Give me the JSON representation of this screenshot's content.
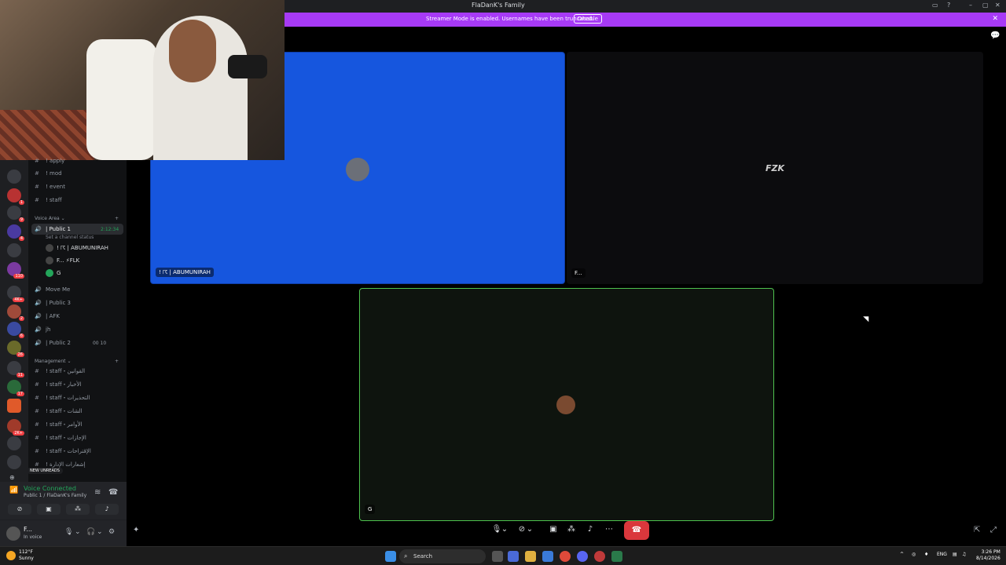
{
  "window": {
    "title": "FlaDanK's Family"
  },
  "banner": {
    "message": "Streamer Mode is enabled. Usernames have been truncated.",
    "disable_label": "Disable"
  },
  "channels": {
    "text": [
      {
        "name": "! apply"
      },
      {
        "name": "! mod"
      },
      {
        "name": "! event"
      },
      {
        "name": "! staff"
      }
    ],
    "voice_area": {
      "category": "Voice Area",
      "active_channel": {
        "name": "| Public 1",
        "timer": "2:12:34",
        "status": "Set a channel status"
      },
      "members": [
        "! ☈ | ABUMUNIRAH",
        "F... ⚡FLK",
        "G"
      ],
      "others": [
        {
          "name": "Move Me"
        },
        {
          "name": "| Public 3"
        },
        {
          "name": "| AFK"
        },
        {
          "name": "jh"
        },
        {
          "name": "| Public 2",
          "count": "00 10"
        }
      ]
    },
    "management": {
      "category": "Management",
      "items": [
        "! staff・القوانين",
        "! staff・الأخبار",
        "! staff・التحذيرات",
        "! staff・الشات",
        "! staff・الأوامر",
        "! staff・الإجازات",
        "! staff・الإقتراحات",
        "! إشعارات الإدارة"
      ]
    },
    "new_unreads": "NEW UNREADS"
  },
  "servers": [
    {
      "badge": ""
    },
    {
      "badge": "1"
    },
    {
      "badge": "9"
    },
    {
      "badge": "4"
    },
    {
      "badge": ""
    },
    {
      "badge": "110"
    },
    {
      "badge": "4K+"
    },
    {
      "badge": "2"
    },
    {
      "badge": "6"
    },
    {
      "badge": "26"
    },
    {
      "badge": "11"
    },
    {
      "badge": "17"
    },
    {
      "badge": ""
    },
    {
      "badge": "2K+"
    },
    {
      "badge": ""
    },
    {
      "badge": ""
    }
  ],
  "voice_panel": {
    "status": "Voice Connected",
    "location": "Public 1 / FlaDanK's Family"
  },
  "user_panel": {
    "name": "F...",
    "status": "In voice"
  },
  "tiles": [
    {
      "label": "! ☈ | ABUMUNIRAH"
    },
    {
      "label": "F...",
      "logo": "FZK"
    },
    {
      "label": "G"
    }
  ],
  "taskbar": {
    "weather_temp": "112°F",
    "weather_desc": "Sunny",
    "search_placeholder": "Search",
    "lang": "ENG",
    "time": "3:26 PM",
    "date": "8/14/2026"
  }
}
